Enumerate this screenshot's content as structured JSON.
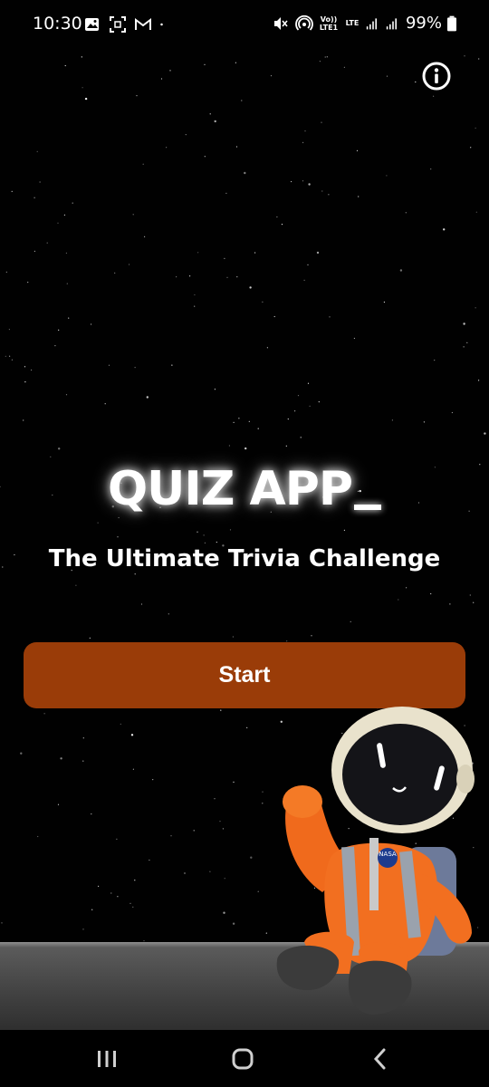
{
  "status_bar": {
    "time": "10:30",
    "battery": "99%",
    "left_icons": [
      "gallery-icon",
      "screenshot-icon",
      "gmail-icon",
      "dot-icon"
    ],
    "right_icons": [
      "mute-icon",
      "hotspot-icon",
      "volte-icon",
      "lte-icon",
      "signal-1-icon",
      "signal-2-icon",
      "battery-icon"
    ],
    "volte_label": "Vo)) LTE1",
    "lte_label": "LTE"
  },
  "header": {
    "info_icon": "info-icon"
  },
  "main": {
    "title": "QUIZ APP",
    "subtitle": "The Ultimate Trivia Challenge",
    "start_label": "Start"
  },
  "illustration": {
    "name": "astronaut-mascot",
    "badge_text": "NASA"
  },
  "nav_bar": {
    "items": [
      "recent-apps-icon",
      "home-icon",
      "back-icon"
    ]
  },
  "colors": {
    "background": "#010101",
    "button": "#9a3c08",
    "text": "#ffffff"
  }
}
